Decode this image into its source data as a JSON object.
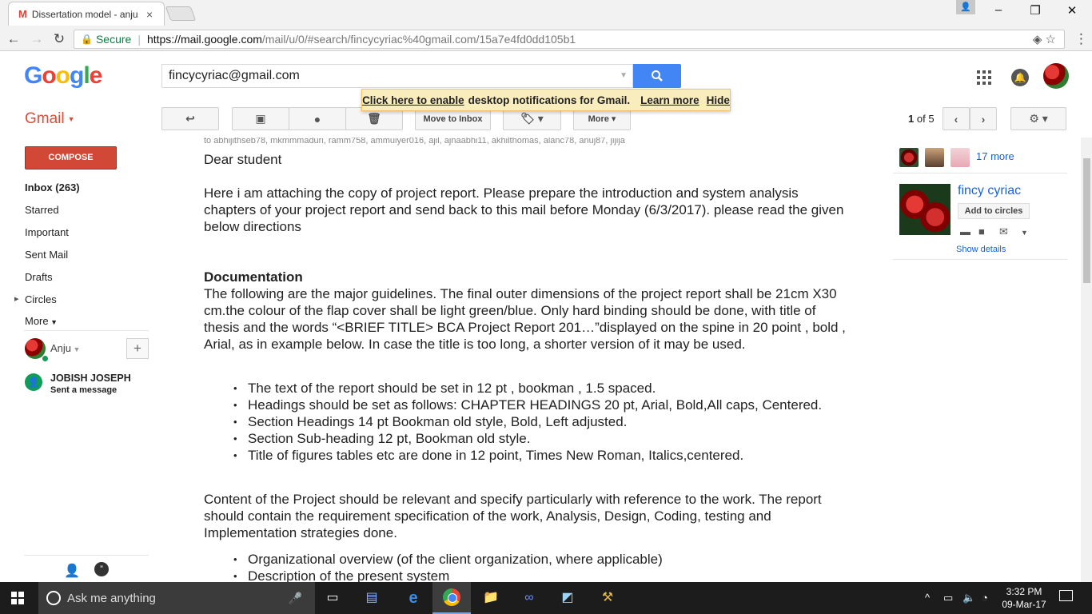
{
  "browser": {
    "tab_title": "Dissertation model - anju",
    "tab_icon": "gmail-M-icon",
    "secure_label": "Secure",
    "url_host": "https://mail.google.com",
    "url_path": "/mail/u/0/#search/fincycyriac%40gmail.com/15a7e4fd0dd105b1"
  },
  "header": {
    "logo_text": "Google",
    "search_value": "fincycyriac@gmail.com"
  },
  "notification": {
    "link_text": "Click here to enable",
    "middle_text": "desktop notifications for Gmail.",
    "learn_more": "Learn more",
    "hide": "Hide"
  },
  "toolbar": {
    "gmail_label": "Gmail",
    "move_to_inbox": "Move to Inbox",
    "more": "More",
    "pager_current": "1",
    "pager_of": "of 5"
  },
  "sidebar": {
    "compose": "COMPOSE",
    "inbox": "Inbox (263)",
    "starred": "Starred",
    "important": "Important",
    "sent": "Sent Mail",
    "drafts": "Drafts",
    "circles": "Circles",
    "more": "More",
    "me_name": "Anju",
    "chat_name": "JOBISH JOSEPH",
    "chat_status": "Sent a message"
  },
  "message": {
    "recipients": "to abhijithseb78, mkmmmaduri, ramm758, ammuiyer016, ajil, ajnaabhi11, akhilthomas, alanc78, anuj87, jijija",
    "greeting": "Dear student",
    "intro": "Here i am attaching the copy of project report. Please prepare the introduction and system analysis chapters of your project report and send back to this mail before Monday (6/3/2017). please read the given below directions",
    "doc_heading": "Documentation",
    "doc_para": " The following are the major guidelines. The final outer dimensions of the project report shall be 21cm X30 cm.the colour of the flap cover shall be light green/blue. Only hard binding should be done, with title of thesis and the words “<BRIEF TITLE> BCA Project Report 201…”displayed on the spine in 20 point , bold , Arial, as in example below. In case the title is too long, a shorter version of it may be used.",
    "bullets": [
      " The text of the report should be set in 12 pt , bookman , 1.5 spaced.",
      " Headings should be set as follows: CHAPTER HEADINGS 20 pt, Arial, Bold,All caps, Centered.",
      " Section Headings 14 pt Bookman old style, Bold, Left adjusted.",
      "Section Sub-heading 12 pt, Bookman old style.",
      "Title of figures tables etc are done in 12 point, Times New Roman, Italics,centered."
    ],
    "content_para": "Content of the Project should be relevant and specify particularly with reference to the work. The report should contain the requirement specification of the work, Analysis, Design, Coding, testing and Implementation strategies done.",
    "bullets2": [
      "Organizational overview (of the client organization, where applicable)",
      "Description of the present system"
    ]
  },
  "right_panel": {
    "more_people": "17 more",
    "contact_name": "fincy cyriac",
    "add_to_circles": "Add to circles",
    "show_details": "Show details"
  },
  "taskbar": {
    "search_placeholder": "Ask me anything",
    "time": "3:32 PM",
    "date": "09-Mar-17"
  },
  "colors": {
    "gmail_red": "#dd4b39",
    "compose_red": "#d14836",
    "search_blue": "#4285f4",
    "link_blue": "#1a62d4",
    "banner_yellow": "#f9edbe"
  }
}
